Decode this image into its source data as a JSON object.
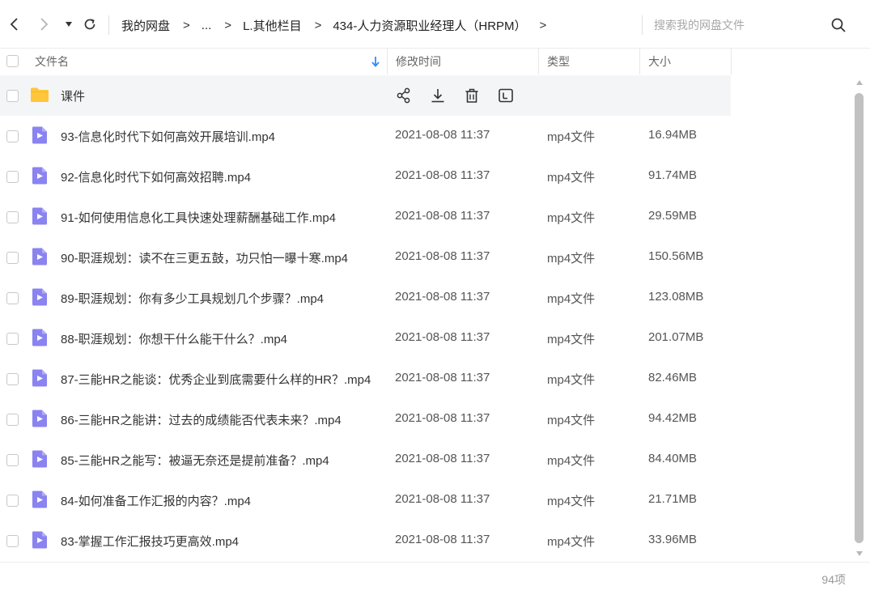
{
  "breadcrumb": {
    "items": [
      "我的网盘",
      "...",
      "L.其他栏目",
      "434-人力资源职业经理人（HRPM）"
    ],
    "separator": ">"
  },
  "search": {
    "placeholder": "搜索我的网盘文件"
  },
  "columns": {
    "name": "文件名",
    "modified": "修改时间",
    "type": "类型",
    "size": "大小"
  },
  "folder": {
    "name": "课件"
  },
  "files": [
    {
      "name": "93-信息化时代下如何高效开展培训.mp4",
      "modified": "2021-08-08 11:37",
      "type": "mp4文件",
      "size": "16.94MB"
    },
    {
      "name": "92-信息化时代下如何高效招聘.mp4",
      "modified": "2021-08-08 11:37",
      "type": "mp4文件",
      "size": "91.74MB"
    },
    {
      "name": "91-如何使用信息化工具快速处理薪酬基础工作.mp4",
      "modified": "2021-08-08 11:37",
      "type": "mp4文件",
      "size": "29.59MB"
    },
    {
      "name": "90-职涯规划：读不在三更五鼓，功只怕一曝十寒.mp4",
      "modified": "2021-08-08 11:37",
      "type": "mp4文件",
      "size": "150.56MB"
    },
    {
      "name": "89-职涯规划：你有多少工具规划几个步骤？.mp4",
      "modified": "2021-08-08 11:37",
      "type": "mp4文件",
      "size": "123.08MB"
    },
    {
      "name": "88-职涯规划：你想干什么能干什么？.mp4",
      "modified": "2021-08-08 11:37",
      "type": "mp4文件",
      "size": "201.07MB"
    },
    {
      "name": "87-三能HR之能谈：优秀企业到底需要什么样的HR？.mp4",
      "modified": "2021-08-08 11:37",
      "type": "mp4文件",
      "size": "82.46MB"
    },
    {
      "name": "86-三能HR之能讲：过去的成绩能否代表未来？.mp4",
      "modified": "2021-08-08 11:37",
      "type": "mp4文件",
      "size": "94.42MB"
    },
    {
      "name": "85-三能HR之能写：被逼无奈还是提前准备？.mp4",
      "modified": "2021-08-08 11:37",
      "type": "mp4文件",
      "size": "84.40MB"
    },
    {
      "name": "84-如何准备工作汇报的内容？.mp4",
      "modified": "2021-08-08 11:37",
      "type": "mp4文件",
      "size": "21.71MB"
    },
    {
      "name": "83-掌握工作汇报技巧更高效.mp4",
      "modified": "2021-08-08 11:37",
      "type": "mp4文件",
      "size": "33.96MB"
    }
  ],
  "footer": {
    "count": "94项"
  },
  "icons": {
    "back": "chevron-left-icon",
    "forward": "chevron-right-icon",
    "history": "caret-down-icon",
    "refresh": "refresh-icon",
    "search": "search-icon",
    "sort": "sort-down-arrow-icon",
    "folder": "folder-icon",
    "video": "video-file-icon",
    "share": "share-icon",
    "download": "download-icon",
    "delete": "trash-icon",
    "rename": "rename-icon"
  },
  "colors": {
    "folder": "#FFC63A",
    "video": "#8A83F0",
    "accent": "#2F8BFF",
    "hover_row": "#F4F5F7"
  }
}
